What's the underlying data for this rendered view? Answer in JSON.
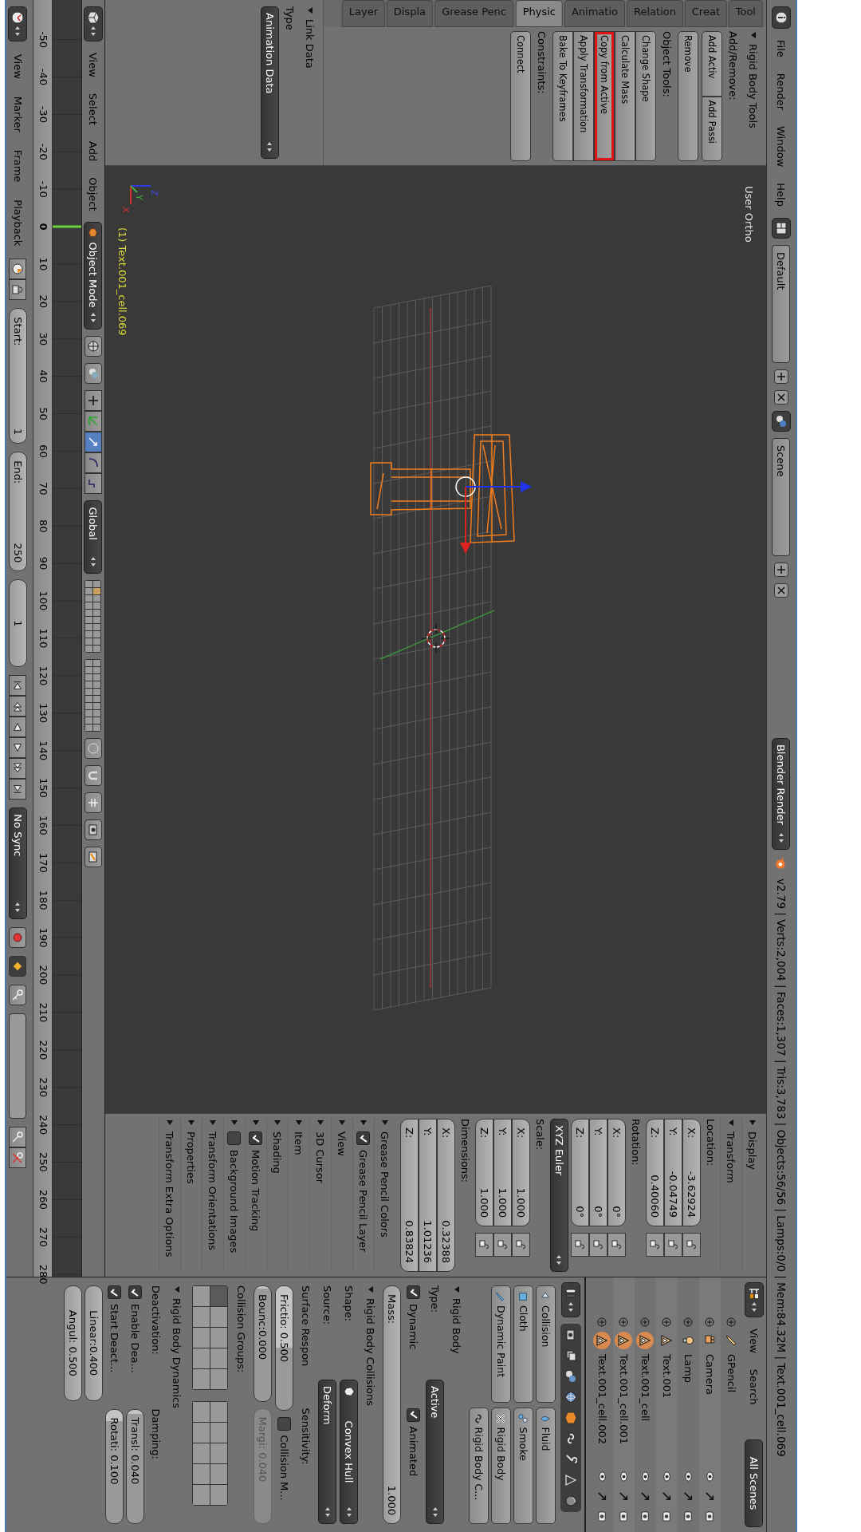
{
  "info_header": {
    "menus": [
      "File",
      "Render",
      "Window",
      "Help"
    ],
    "screen_layout": "Default",
    "scene": "Scene",
    "render_engine": "Blender Render",
    "stats": "v2.79 | Verts:2,004 | Faces:1,307 | Tris:3,783 | Objects:56/56 | Lamps:0/0 | Mem:84.32M | Text.001_cell.069"
  },
  "tool_shelf": {
    "tabs": [
      {
        "label": "Layer",
        "selected": false
      },
      {
        "label": "Displa",
        "selected": false
      },
      {
        "label": "Grease Penc",
        "selected": false
      },
      {
        "label": "Physic",
        "selected": true
      },
      {
        "label": "Animatio",
        "selected": false
      },
      {
        "label": "Relation",
        "selected": false
      },
      {
        "label": "Creat",
        "selected": false
      },
      {
        "label": "Tool",
        "selected": false
      }
    ],
    "panel": {
      "title": "Rigid Body Tools",
      "expanded": true,
      "items": [
        {
          "kind": "label",
          "text": "Add/Remove:"
        },
        {
          "kind": "row",
          "buttons": [
            {
              "label": "Add Activ",
              "highlighted": false
            },
            {
              "label": "Add Passi",
              "highlighted": false
            }
          ]
        },
        {
          "kind": "column",
          "buttons": [
            {
              "label": "Remove",
              "highlighted": false
            }
          ]
        },
        {
          "kind": "label",
          "text": "Object Tools:"
        },
        {
          "kind": "column",
          "buttons": [
            {
              "label": "Change Shape",
              "highlighted": false
            },
            {
              "label": "Calculate Mass",
              "highlighted": false
            },
            {
              "label": "Copy from Active",
              "highlighted": true
            },
            {
              "label": "Apply Transformation",
              "highlighted": false
            },
            {
              "label": "Bake To Keyframes",
              "highlighted": false
            }
          ]
        },
        {
          "kind": "label",
          "text": "Constraints:"
        },
        {
          "kind": "column",
          "buttons": [
            {
              "label": "Connect",
              "highlighted": false
            }
          ]
        }
      ]
    }
  },
  "operator_panel": {
    "title": "Link Data",
    "expanded": true,
    "field_label": "Type",
    "value": "Animation Data"
  },
  "viewport": {
    "view_name": "User Ortho",
    "object_label": "(1) Text.001_cell.069",
    "axis_labels": [
      "Z",
      "Y",
      "X"
    ]
  },
  "view3d_header": {
    "menus": [
      "View",
      "Select",
      "Add",
      "Object"
    ],
    "mode": "Object Mode",
    "orientation": "Global"
  },
  "n_panel": {
    "panels": [
      {
        "kind": "header",
        "title": "Display",
        "expanded": false
      },
      {
        "kind": "transform",
        "title": "Transform",
        "expanded": true,
        "groups": [
          {
            "label": "Location:",
            "lockable": true,
            "fields": [
              {
                "axis": "X:",
                "value": "-3.62924"
              },
              {
                "axis": "Y:",
                "value": "-0.04749"
              },
              {
                "axis": "Z:",
                "value": "0.40060"
              }
            ]
          },
          {
            "label": "Rotation:",
            "lockable": true,
            "fields": [
              {
                "axis": "X:",
                "value": "0°"
              },
              {
                "axis": "Y:",
                "value": "0°"
              },
              {
                "axis": "Z:",
                "value": "0°"
              }
            ],
            "mode": "XYZ Euler"
          },
          {
            "label": "Scale:",
            "lockable": true,
            "fields": [
              {
                "axis": "X:",
                "value": "1.000"
              },
              {
                "axis": "Y:",
                "value": "1.000"
              },
              {
                "axis": "Z:",
                "value": "1.000"
              }
            ]
          },
          {
            "label": "Dimensions:",
            "lockable": false,
            "fields": [
              {
                "axis": "X:",
                "value": "0.32388"
              },
              {
                "axis": "Y:",
                "value": "1.01236"
              },
              {
                "axis": "Z:",
                "value": "0.83824"
              }
            ]
          }
        ]
      },
      {
        "kind": "header",
        "title": "Grease Pencil Colors",
        "expanded": false
      },
      {
        "kind": "check_header",
        "title": "Grease Pencil Layer",
        "expanded": false,
        "checked": true
      },
      {
        "kind": "header",
        "title": "View",
        "expanded": false
      },
      {
        "kind": "header",
        "title": "3D Cursor",
        "expanded": false
      },
      {
        "kind": "header",
        "title": "Item",
        "expanded": false
      },
      {
        "kind": "header",
        "title": "Shading",
        "expanded": false
      },
      {
        "kind": "check_header",
        "title": "Motion Tracking",
        "expanded": false,
        "checked": true
      },
      {
        "kind": "check_header",
        "title": "Background Images",
        "expanded": false,
        "checked": false
      },
      {
        "kind": "header",
        "title": "Transform Orientations",
        "expanded": false
      },
      {
        "kind": "header",
        "title": "Properties",
        "expanded": false
      },
      {
        "kind": "header",
        "title": "Transform Extra Options",
        "expanded": false
      }
    ]
  },
  "timeline": {
    "menus": [
      "View",
      "Marker",
      "Frame",
      "Playback"
    ],
    "start_label": "Start:",
    "start": "1",
    "end_label": "End:",
    "end": "250",
    "current_frame": "1",
    "sync": "No Sync",
    "ruler_ticks": [
      {
        "label": "-50",
        "current": false
      },
      {
        "label": "-40",
        "current": false
      },
      {
        "label": "-30",
        "current": false
      },
      {
        "label": "-20",
        "current": false
      },
      {
        "label": "-10",
        "current": false
      },
      {
        "label": "0",
        "current": true
      },
      {
        "label": "10",
        "current": false
      },
      {
        "label": "20",
        "current": false
      },
      {
        "label": "30",
        "current": false
      },
      {
        "label": "40",
        "current": false
      },
      {
        "label": "50",
        "current": false
      },
      {
        "label": "60",
        "current": false
      },
      {
        "label": "70",
        "current": false
      },
      {
        "label": "80",
        "current": false
      },
      {
        "label": "90",
        "current": false
      },
      {
        "label": "100",
        "current": false
      },
      {
        "label": "110",
        "current": false
      },
      {
        "label": "120",
        "current": false
      },
      {
        "label": "130",
        "current": false
      },
      {
        "label": "140",
        "current": false
      },
      {
        "label": "150",
        "current": false
      },
      {
        "label": "160",
        "current": false
      },
      {
        "label": "170",
        "current": false
      },
      {
        "label": "180",
        "current": false
      },
      {
        "label": "190",
        "current": false
      },
      {
        "label": "200",
        "current": false
      },
      {
        "label": "210",
        "current": false
      },
      {
        "label": "220",
        "current": false
      },
      {
        "label": "230",
        "current": false
      },
      {
        "label": "240",
        "current": false
      },
      {
        "label": "250",
        "current": false
      },
      {
        "label": "260",
        "current": false
      },
      {
        "label": "270",
        "current": false
      },
      {
        "label": "280",
        "current": false
      }
    ]
  },
  "outliner": {
    "menus": [
      "View",
      "Search"
    ],
    "filter": "All Scenes",
    "items": [
      {
        "name": "GPencil",
        "kind": "grease_pencil",
        "selected": false
      },
      {
        "name": "Camera",
        "kind": "camera",
        "selected": false
      },
      {
        "name": "Lamp",
        "kind": "lamp",
        "selected": false
      },
      {
        "name": "Text.001",
        "kind": "mesh",
        "selected": false
      },
      {
        "name": "Text.001_cell",
        "kind": "mesh",
        "selected": true
      },
      {
        "name": "Text.001_cell.001",
        "kind": "mesh",
        "selected": true
      },
      {
        "name": "Text.001_cell.002",
        "kind": "mesh",
        "selected": true
      }
    ]
  },
  "properties": {
    "physics_left": [
      {
        "label": "Collision",
        "kind": "collision"
      },
      {
        "label": "Cloth",
        "kind": "cloth"
      },
      {
        "label": "Dynamic Paint",
        "kind": "paint"
      }
    ],
    "physics_right": [
      {
        "label": "Fluid",
        "kind": "fluid"
      },
      {
        "label": "Smoke",
        "kind": "smoke"
      },
      {
        "label": "Rigid Body",
        "kind": "remove"
      },
      {
        "label": "Rigid Body C...",
        "kind": "constraint"
      }
    ],
    "rigid_body": {
      "title": "Rigid Body",
      "expanded": true,
      "type_label": "Type:",
      "type": "Active",
      "dynamic": {
        "label": "Dynamic",
        "checked": true
      },
      "animated": {
        "label": "Animated",
        "checked": true
      },
      "mass": "Mass:",
      "mass_value": "1.000"
    },
    "collisions": {
      "title": "Rigid Body Collisions",
      "expanded": true,
      "shape_label": "Shape:",
      "shape": "Convex Hull",
      "source_label": "Source:",
      "source": "Deform",
      "surface_label": "Surface Respon",
      "sensitivity_label": "Sensitivity:",
      "friction": {
        "text": "Frictio: 0.500",
        "level": 0.5
      },
      "bounciness": {
        "text": "Bounc:0.000",
        "level": 0
      },
      "collision_margin": {
        "label": "Collision M...",
        "checked": false
      },
      "margin": {
        "text": "Margi: 0.040",
        "disabled": true
      },
      "groups_label": "Collision Groups:",
      "groups": [
        [
          {
            "selected": true
          },
          {
            "selected": false
          },
          {
            "selected": false
          },
          {
            "selected": false
          },
          {
            "selected": false
          },
          {
            "selected": false
          },
          {
            "selected": false
          },
          {
            "selected": false
          },
          {
            "selected": false
          },
          {
            "selected": false
          }
        ],
        [
          {
            "selected": false
          },
          {
            "selected": false
          },
          {
            "selected": false
          },
          {
            "selected": false
          },
          {
            "selected": false
          },
          {
            "selected": false
          },
          {
            "selected": false
          },
          {
            "selected": false
          },
          {
            "selected": false
          },
          {
            "selected": false
          }
        ]
      ]
    },
    "dynamics": {
      "title": "Rigid Body Dynamics",
      "expanded": true,
      "deactivation_label": "Deactivation:",
      "damping_label": "Damping:",
      "enable_deactivation": {
        "label": "Enable Dea...",
        "checked": true
      },
      "start_deactivated": {
        "label": "Start Deact...",
        "checked": true
      },
      "linear": {
        "text": "Linear:0.400"
      },
      "angular": {
        "text": "Angul: 0.500"
      },
      "translation": {
        "text": "Transl: 0.040",
        "level": 0.04
      },
      "rotation": {
        "text": "Rotati: 0.100",
        "level": 0.1
      }
    }
  }
}
